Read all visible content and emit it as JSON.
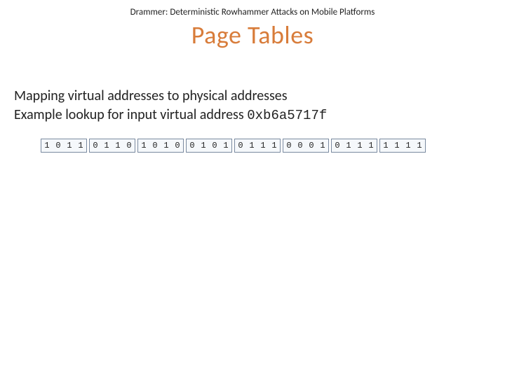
{
  "header": "Drammer: Deterministic Rowhammer Attacks on Mobile Platforms",
  "title": "Page Tables",
  "body_line1": "Mapping virtual addresses to physical addresses",
  "body_line2_prefix": "Example lookup for input virtual address ",
  "body_line2_addr": "0xb6a5717f",
  "bit_groups": [
    [
      "1",
      "0",
      "1",
      "1"
    ],
    [
      "0",
      "1",
      "1",
      "0"
    ],
    [
      "1",
      "0",
      "1",
      "0"
    ],
    [
      "0",
      "1",
      "0",
      "1"
    ],
    [
      "0",
      "1",
      "1",
      "1"
    ],
    [
      "0",
      "0",
      "0",
      "1"
    ],
    [
      "0",
      "1",
      "1",
      "1"
    ],
    [
      "1",
      "1",
      "1",
      "1"
    ]
  ]
}
